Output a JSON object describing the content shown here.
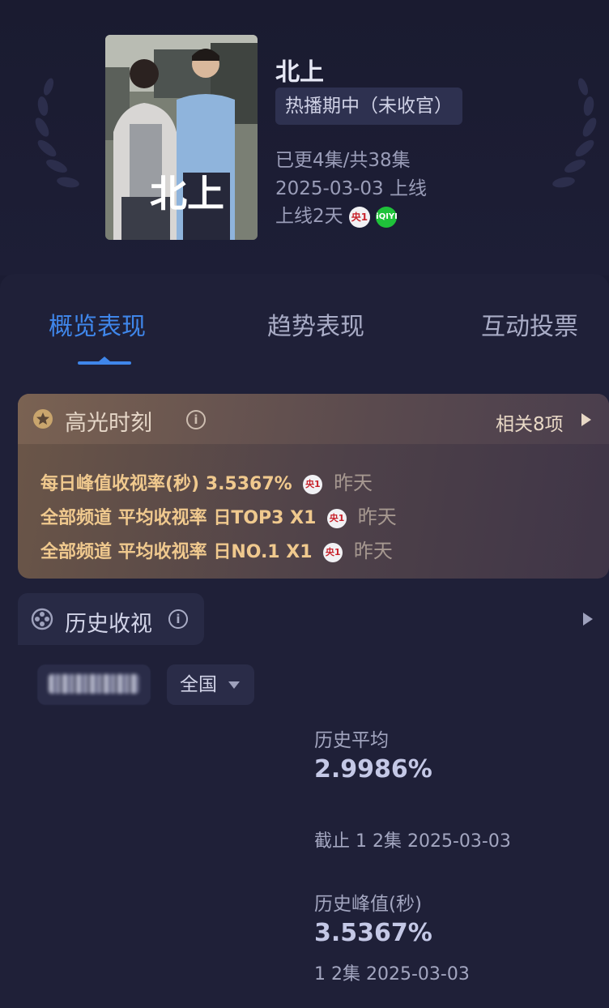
{
  "show": {
    "title": "北上",
    "status": "热播期中（未收官）",
    "episodes": "已更4集/共38集",
    "premiere": "2025-03-03 上线",
    "days_online": "上线2天",
    "poster_text": "北上",
    "channels": [
      {
        "icon": "cctv1-icon",
        "label": "央1"
      },
      {
        "icon": "iqiyi-icon",
        "label": "iQIYI"
      }
    ]
  },
  "tabs": [
    {
      "label": "概览表现",
      "active": true
    },
    {
      "label": "趋势表现",
      "active": false
    },
    {
      "label": "互动投票",
      "active": false
    }
  ],
  "highlights": {
    "title": "高光时刻",
    "related": "相关8项",
    "items": [
      {
        "text": "每日峰值收视率(秒)  3.5367%",
        "channel": "央1",
        "when": "昨天"
      },
      {
        "text": "全部频道 平均收视率 日TOP3 X1",
        "channel": "央1",
        "when": "昨天"
      },
      {
        "text": "全部频道 平均收视率 日NO.1 X1",
        "channel": "央1",
        "when": "昨天"
      }
    ]
  },
  "history": {
    "title": "历史收视",
    "region": "全国",
    "avg_label": "历史平均",
    "avg_value": "2.9986%",
    "avg_note": "截止 1 2集 2025-03-03",
    "peak_label": "历史峰值(秒)",
    "peak_value": "3.5367%",
    "peak_note": "1 2集 2025-03-03"
  },
  "colors": {
    "background": "#1b1c33",
    "accent": "#3f86ea",
    "highlight_gold": "#f0c98e"
  }
}
